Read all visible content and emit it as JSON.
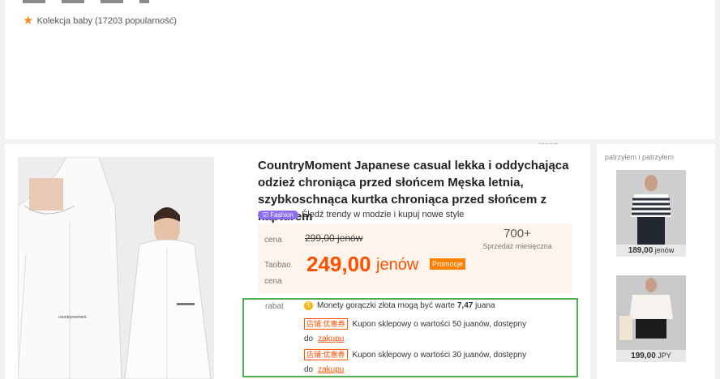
{
  "collection": {
    "text": "Kolekcja baby (17203 popularność)"
  },
  "raport": "raport",
  "product": {
    "title": "CountryMoment Japanese casual lekka i oddychająca odzież chroniąca przed słońcem Męska letnia, szybkoschnąca kurtka chroniąca przed słońcem z kapturem",
    "brand_print": "countrymoment",
    "fashion_badge": "Fashion",
    "fashion_text": "Śledź trendy w modzie i kupuj nowe style"
  },
  "price": {
    "label": "cena",
    "old": "299,00 jenów",
    "sales_count": "700+",
    "sales_label": "Sprzedaż miesięczna",
    "taobao_label": "Taobao cena",
    "new_value": "249,00",
    "new_currency": "jenów",
    "promo": "Promocje"
  },
  "discount": {
    "label": "rabat",
    "coin_text_prefix": "Monety gorączki złota mogą być warte",
    "coin_value": "7,47",
    "coin_unit": "juana",
    "coupons": [
      {
        "tag": "店铺:优惠券",
        "text": "Kupon sklepowy o wartości 50 juanów, dostępny do",
        "link": "zakupu"
      },
      {
        "tag": "店铺:优惠券",
        "text": "Kupon sklepowy o wartości 30 juanów, dostępny do",
        "link": "zakupu"
      }
    ]
  },
  "sidebar": {
    "title": "patrzyłem i patrzyłem",
    "items": [
      {
        "price_value": "189,00",
        "price_unit": "jenów"
      },
      {
        "price_value": "199,00",
        "price_unit": "JPY"
      }
    ]
  },
  "colors": {
    "accent": "#ff5000",
    "badge": "#8b6df2",
    "highlight_border": "#4caf50"
  }
}
